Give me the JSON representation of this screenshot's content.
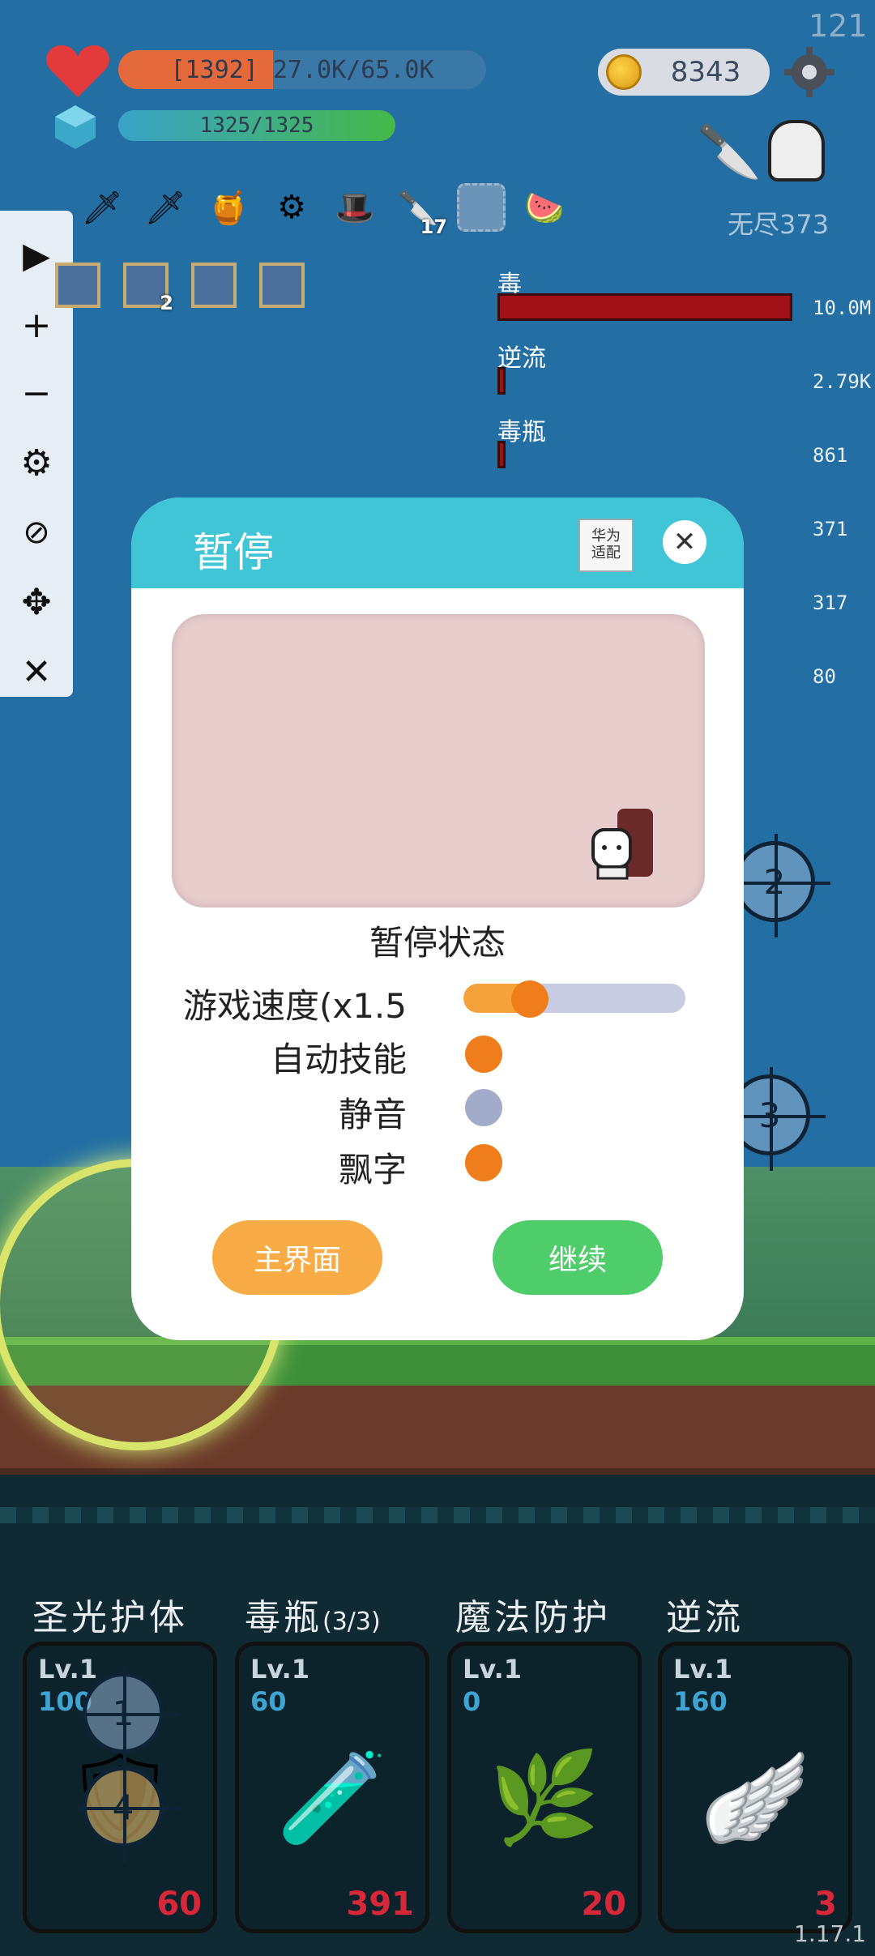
{
  "hud": {
    "fps": "121",
    "hp_text": "[1392] 27.0K/65.0K",
    "hp_fraction": 0.42,
    "mp_text": "1325/1325",
    "mp_fraction": 1.0,
    "coins": "8343",
    "mode_label": "无尽373",
    "version": "1.17.1"
  },
  "side_panel": {
    "buttons": [
      "play-icon",
      "plus-icon",
      "minus-icon",
      "gear-icon",
      "eye-off-icon",
      "move-icon",
      "close-icon"
    ]
  },
  "items": [
    {
      "icon": "green-sword-icon",
      "glyph": "🗡",
      "badge": ""
    },
    {
      "icon": "sword-icon",
      "glyph": "🗡",
      "badge": ""
    },
    {
      "icon": "jam-jar-icon",
      "glyph": "🍯",
      "badge": ""
    },
    {
      "icon": "sawblade-icon",
      "glyph": "⚙",
      "badge": ""
    },
    {
      "icon": "wizard-hat-icon",
      "glyph": "🎩",
      "badge": ""
    },
    {
      "icon": "dagger-icon",
      "glyph": "🔪",
      "badge": "17"
    },
    {
      "icon": "empty-slot-icon",
      "glyph": "",
      "badge": ""
    },
    {
      "icon": "watermelon-icon",
      "glyph": "🍉",
      "badge": ""
    }
  ],
  "runes": [
    {
      "icon": "rune-gold-icon",
      "badge": ""
    },
    {
      "icon": "rune-blue-icon",
      "badge": "2"
    },
    {
      "icon": "rune-scroll-icon",
      "badge": ""
    },
    {
      "icon": "rune-light-icon",
      "badge": ""
    }
  ],
  "damage_stats": [
    {
      "label": "毒",
      "value": "10.0M",
      "fraction": 1.0
    },
    {
      "label": "逆流",
      "value": "2.79K",
      "fraction": 0.02
    },
    {
      "label": "毒瓶",
      "value": "861",
      "fraction": 0.02
    },
    {
      "label": "",
      "value": "371",
      "fraction": 0
    },
    {
      "label": "",
      "value": "317",
      "fraction": 0
    },
    {
      "label": "",
      "value": "80",
      "fraction": 0
    }
  ],
  "pause_modal": {
    "title": "暂停",
    "huawei_label_1": "华为",
    "huawei_label_2": "适配",
    "close_icon": "close-icon",
    "state_label": "暂停状态",
    "speed_label": "游戏速度(x1.5",
    "speed_fraction": 0.3,
    "options": [
      {
        "label": "自动技能",
        "on": true
      },
      {
        "label": "静音",
        "on": false
      },
      {
        "label": "飘字",
        "on": true
      }
    ],
    "main_button": "主界面",
    "continue_button": "继续",
    "colors": {
      "header": "#40c5d6",
      "on": "#f07d1b",
      "off": "#a2abc9",
      "main_btn": "#f9ab45",
      "continue_btn": "#4fcd6a"
    }
  },
  "targets": [
    "1",
    "2",
    "3",
    "4"
  ],
  "skills": [
    {
      "name": "圣光护体",
      "suffix": "",
      "level": "Lv.1",
      "stat": "100",
      "count": "60",
      "icon": "holy-shield-icon",
      "glyph": "🛡"
    },
    {
      "name": "毒瓶",
      "suffix": "(3/3)",
      "level": "Lv.1",
      "stat": "60",
      "count": "391",
      "icon": "poison-bottle-icon",
      "glyph": "🧪"
    },
    {
      "name": "魔法防护",
      "suffix": "",
      "level": "Lv.1",
      "stat": "0",
      "count": "20",
      "icon": "leaf-icon",
      "glyph": "🌿"
    },
    {
      "name": "逆流",
      "suffix": "",
      "level": "Lv.1",
      "stat": "160",
      "count": "3",
      "icon": "wing-icon",
      "glyph": "🪽"
    }
  ]
}
